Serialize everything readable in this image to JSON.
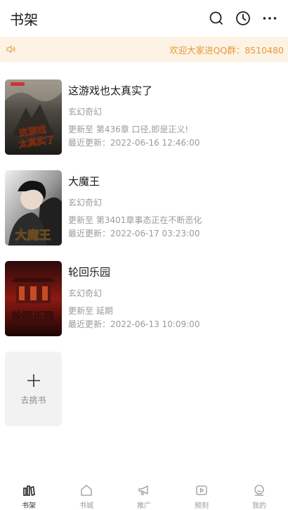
{
  "header": {
    "title": "书架",
    "actions": [
      "search-icon",
      "clock-icon",
      "more-icon"
    ]
  },
  "notice": {
    "icon": "speaker-icon",
    "text": "欢迎大家进QQ群：8510480",
    "color": "#e69a3a",
    "background": "#fdf3e4"
  },
  "books": [
    {
      "title": "这游戏也太真实了",
      "genre": "玄幻奇幻",
      "latest": "更新至 第436章 口径,即是正义!",
      "updated": "最近更新：2022-06-16 12:46:00",
      "cover_text": "这游戏也太真实了"
    },
    {
      "title": "大魔王",
      "genre": "玄幻奇幻",
      "latest": "更新至 第3401章事态正在不断恶化",
      "updated": "最近更新：2022-06-17 03:23:00",
      "cover_text": "大魔王"
    },
    {
      "title": "轮回乐园",
      "genre": "玄幻奇幻",
      "latest": "更新至 延期",
      "updated": "最近更新：2022-06-13 10:09:00",
      "cover_text": "轮回乐园"
    }
  ],
  "add_book": {
    "icon": "plus-icon",
    "label": "去挑书"
  },
  "tabbar": {
    "active": "书架",
    "items": [
      {
        "label": "书架",
        "icon": "bookshelf-icon"
      },
      {
        "label": "书城",
        "icon": "home-icon"
      },
      {
        "label": "推广",
        "icon": "megaphone-icon"
      },
      {
        "label": "频刻",
        "icon": "video-icon"
      },
      {
        "label": "我的",
        "icon": "profile-icon"
      }
    ]
  }
}
